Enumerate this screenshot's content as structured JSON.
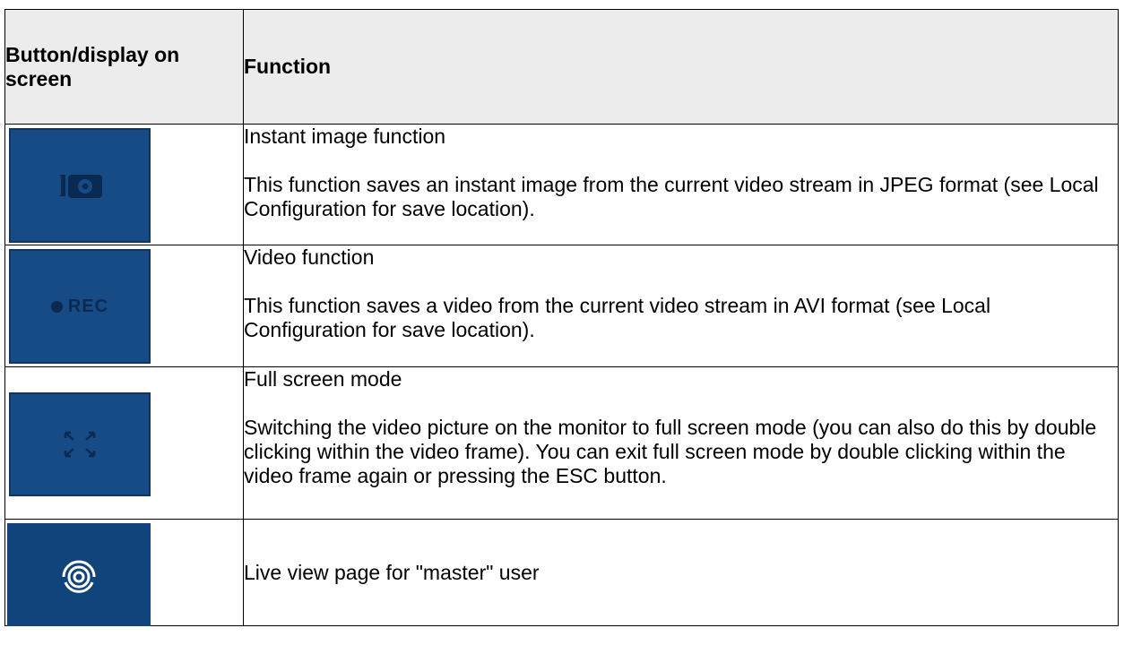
{
  "header": {
    "col1": "Button/display on screen",
    "col2": "Function"
  },
  "rows": [
    {
      "icon": "camera-icon",
      "title": "Instant image function",
      "description": "This function saves an instant image from the current video stream in JPEG format (see Local Configuration for save location)."
    },
    {
      "icon": "record-icon",
      "icon_label": "REC",
      "title": "Video function",
      "description": "This function saves a video from the current video stream in AVI format (see Local Configuration for save location)."
    },
    {
      "icon": "fullscreen-icon",
      "title": "Full screen mode",
      "description": "Switching the video picture on the monitor to full screen mode (you can also do this by double clicking within the video frame). You can exit full screen mode by double clicking within the video frame again or pressing the ESC button."
    },
    {
      "icon": "live-view-icon",
      "title": "Live view page for \"master\" user"
    }
  ],
  "colors": {
    "button_background": "#164b86",
    "icon_dark": "#0b2a52",
    "header_background": "#ececec"
  }
}
